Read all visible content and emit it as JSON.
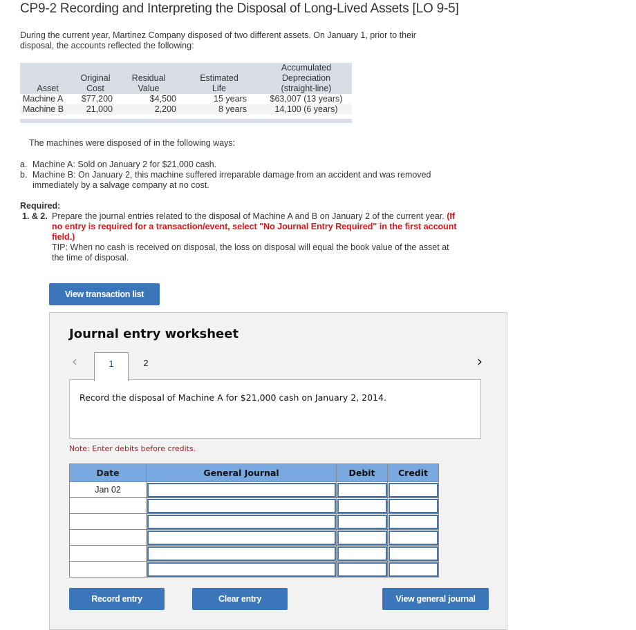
{
  "title": "CP9-2 Recording and Interpreting the Disposal of Long-Lived Assets [LO 9-5]",
  "intro": "During the current year, Martinez Company disposed of two different assets. On January 1, prior to their disposal, the accounts reflected the following:",
  "asset_table": {
    "headers": [
      "Asset",
      "Original Cost",
      "Residual Value",
      "Estimated Life",
      "Accumulated Depreciation (straight-line)"
    ],
    "header_lines": [
      [
        "",
        "",
        "",
        "",
        "Accumulated"
      ],
      [
        "",
        "Original",
        "Residual",
        "Estimated",
        "Depreciation"
      ],
      [
        "Asset",
        "Cost",
        "Value",
        "Life",
        "(straight-line)"
      ]
    ],
    "rows": [
      [
        "Machine A",
        "$77,200",
        "$4,500",
        "15 years",
        "$63,007 (13 years)"
      ],
      [
        "Machine B",
        "21,000",
        "2,200",
        "8 years",
        "14,100 (6 years)"
      ]
    ]
  },
  "disposal_intro": "The machines were disposed of in the following ways:",
  "disposals": [
    {
      "label": "a.",
      "text": "Machine A: Sold on January 2 for $21,000 cash."
    },
    {
      "label": "b.",
      "text": "Machine B: On January 2, this machine suffered irreparable damage from an accident and was removed immediately by a salvage company at no cost."
    }
  ],
  "required": {
    "heading": "Required:",
    "number": "1. & 2.",
    "text": "Prepare the journal entries related to the disposal of Machine A and B on January 2 of the current year.",
    "instruction": "(If no entry is required for a transaction/event, select \"No Journal Entry Required\" in the first account field.)",
    "tip": "TIP: When no cash is received on disposal, the loss on disposal will equal the book value of the asset at the time of disposal."
  },
  "buttons": {
    "view_transaction_list": "View transaction list",
    "record_entry": "Record entry",
    "clear_entry": "Clear entry",
    "view_general_journal": "View general journal"
  },
  "worksheet": {
    "title": "Journal entry worksheet",
    "prev_icon": "‹",
    "next_icon": "›",
    "tabs": [
      "1",
      "2"
    ],
    "active_tab": "1",
    "description": "Record the disposal of Machine A for $21,000 cash on January 2, 2014.",
    "note": "Note: Enter debits before credits.",
    "journal": {
      "headers": [
        "Date",
        "General Journal",
        "Debit",
        "Credit"
      ],
      "rows": [
        {
          "date": "Jan 02",
          "account": "",
          "debit": "",
          "credit": ""
        },
        {
          "date": "",
          "account": "",
          "debit": "",
          "credit": ""
        },
        {
          "date": "",
          "account": "",
          "debit": "",
          "credit": ""
        },
        {
          "date": "",
          "account": "",
          "debit": "",
          "credit": ""
        },
        {
          "date": "",
          "account": "",
          "debit": "",
          "credit": ""
        },
        {
          "date": "",
          "account": "",
          "debit": "",
          "credit": ""
        }
      ]
    }
  },
  "colors": {
    "button_blue": "#3a76b9",
    "journal_header": "#79a9e0",
    "instruction_red": "#e0151c",
    "note_red": "#a8262c"
  }
}
